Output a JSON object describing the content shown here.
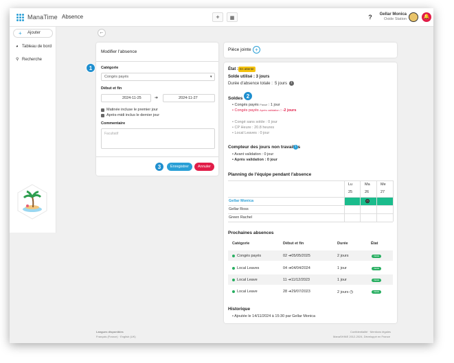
{
  "app": {
    "name": "ManaTime",
    "section": "Absence",
    "help": "?",
    "user_name": "Gellar Monica",
    "user_org": "Oxide Station"
  },
  "sidebar": {
    "add": "Ajouter",
    "items": [
      {
        "label": "Tableau de bord"
      },
      {
        "label": "Recherche"
      }
    ]
  },
  "form": {
    "title": "Modifier l'absence",
    "category_label": "Catégorie",
    "category_value": "Congés payés",
    "dates_label": "Début et fin",
    "start": "2024-11-25",
    "end": "2024-11-27",
    "morning": "Matinée incluse le premier jour",
    "afternoon": "Après-midi inclus le dernier jour",
    "comment_label": "Commentaire",
    "comment_placeholder": "Facultatif",
    "save": "Enregistrer",
    "cancel": "Annuler"
  },
  "attachment": {
    "title": "Pièce jointe"
  },
  "details": {
    "state_label": "État :",
    "state_value": "En attente",
    "used": "Solde utilisé : 3 jours",
    "duration_label": "Durée d'absence totale :",
    "duration_value": "5 jours",
    "balances_title": "Soldes",
    "bal1_label": "Congés payés",
    "bal1_sub": "Passé",
    "bal1_value": ": 1 jour",
    "bal2_label": "Congés payés",
    "bal2_sub": "Après validation",
    "bal2_value": ": -2 jours",
    "bal3": "Congé sans solde : 0 jour",
    "bal4": "CP Heure : 20.8 heures",
    "bal5": "Local Leaves : 0 jour",
    "counter_title": "Compteur des jours non travaillés",
    "counter1": "Avant validation : 0 jour",
    "counter2": "Après validation : 0 jour",
    "planning_title": "Planning de l'équipe pendant l'absence",
    "days": [
      "Lu",
      "Ma",
      "Me"
    ],
    "dates": [
      "25",
      "26",
      "27"
    ],
    "members": [
      "Gellar Monica",
      "Gellar Ross",
      "Green Rachel"
    ],
    "upcoming_title": "Prochaines absences",
    "cols": [
      "Catégorie",
      "Début et fin",
      "Durée",
      "État"
    ],
    "rows": [
      {
        "cat": "Congés payés",
        "start": "02",
        "end": "05/05/2025",
        "dur": "2 jours",
        "state": "Validé"
      },
      {
        "cat": "Local Leaves",
        "start": "04",
        "end": "04/04/2024",
        "dur": "1 jour",
        "state": "Validé"
      },
      {
        "cat": "Local Leave",
        "start": "11",
        "end": "11/12/2023",
        "dur": "1 jour",
        "state": "Validé"
      },
      {
        "cat": "Local Leave",
        "start": "28",
        "end": "29/07/2023",
        "dur": "2 jours",
        "state": "Validé"
      }
    ],
    "history_title": "Historique",
    "history1": "Ajoutée le 14/11/2024 à 15:30 par Gellar Monica"
  },
  "footer": {
    "langs_title": "Langues disponibles",
    "langs": "Français (France) · English (UK)",
    "legal": "Confidentialité · Mentions légales",
    "copy": "ManaSHINE 2012-2024, Développé en France"
  },
  "colors": {
    "accent": "#2a9fd6",
    "danger": "#e11d48",
    "success": "#27ae60",
    "pending": "#f4c20d"
  }
}
